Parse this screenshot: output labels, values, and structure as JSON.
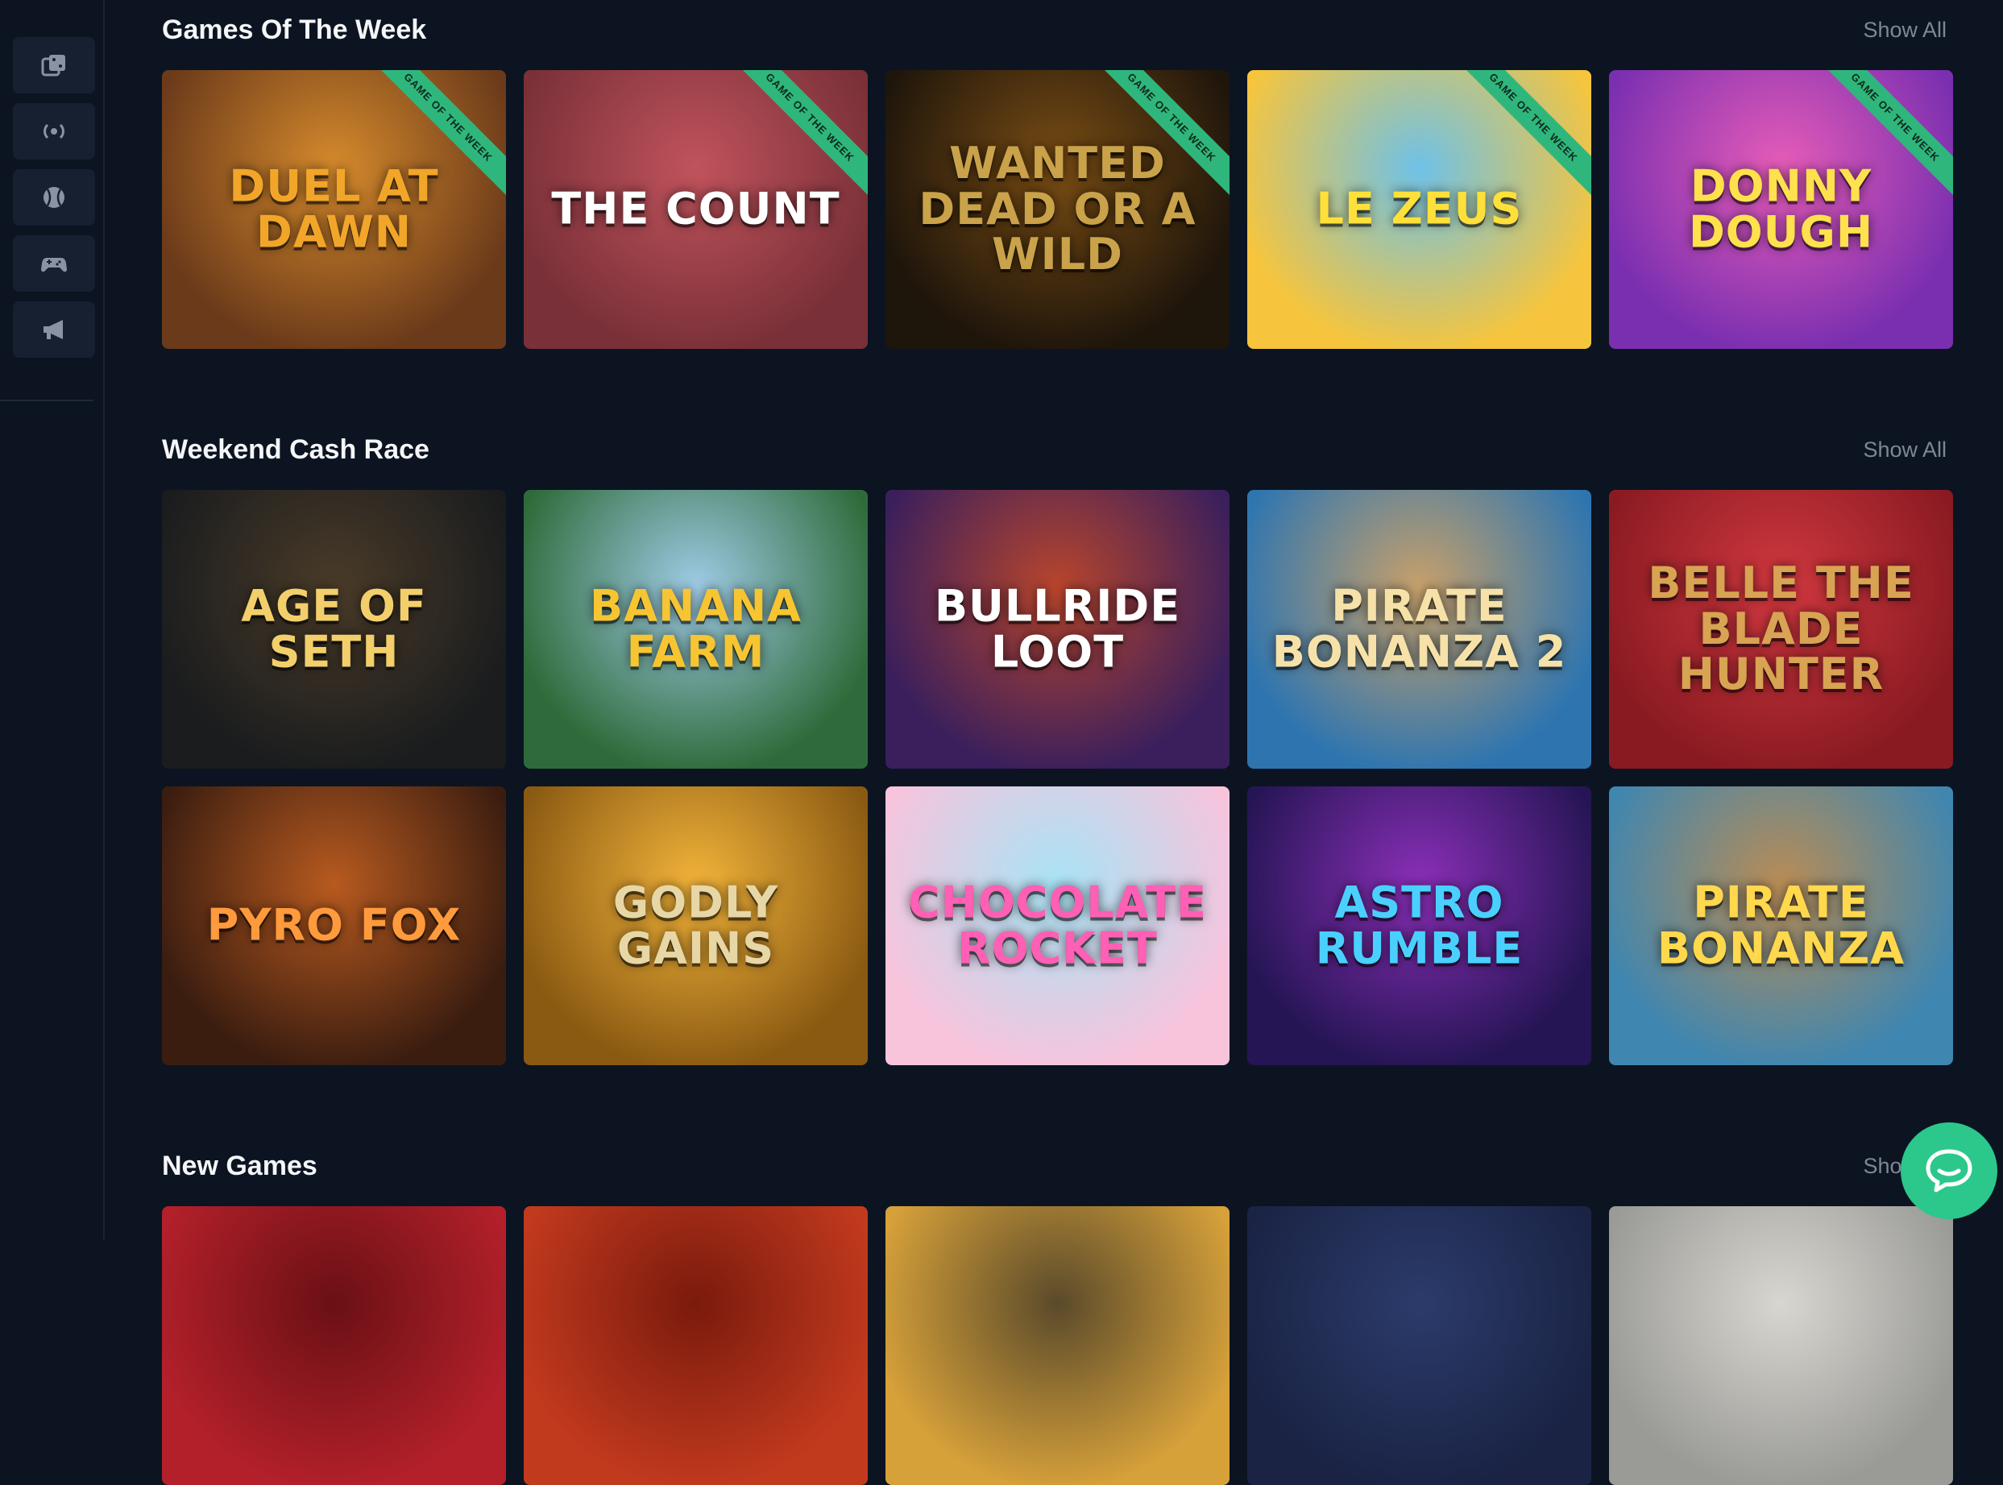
{
  "sidebar": {
    "items": [
      {
        "icon": "casino-icon"
      },
      {
        "icon": "live-icon"
      },
      {
        "icon": "sports-ball-icon"
      },
      {
        "icon": "gamepad-icon"
      },
      {
        "icon": "megaphone-icon"
      }
    ]
  },
  "sections": [
    {
      "title": "Games Of The Week",
      "show_all": "Show All",
      "ribbon_label": "GAME OF THE WEEK",
      "games": [
        {
          "title": "Duel at Dawn",
          "bg1": "#6b3a1a",
          "bg2": "#d58a2c",
          "text_color": "#f2a629"
        },
        {
          "title": "The Count",
          "bg1": "#7a3038",
          "bg2": "#c0535c",
          "text_color": "#ffffff"
        },
        {
          "title": "Wanted Dead or a Wild",
          "bg1": "#1e150b",
          "bg2": "#7a4d14",
          "text_color": "#c9a24a"
        },
        {
          "title": "Le Zeus",
          "bg1": "#f6c53d",
          "bg2": "#6ec2e8",
          "text_color": "#ffe03a"
        },
        {
          "title": "Donny Dough",
          "bg1": "#7a2fb0",
          "bg2": "#e65cb8",
          "text_color": "#ffe14d"
        }
      ]
    },
    {
      "title": "Weekend Cash Race",
      "show_all": "Show All",
      "games": [
        {
          "title": "Age of Seth",
          "bg1": "#1a1c1e",
          "bg2": "#4a3b28",
          "text_color": "#f3cf6b"
        },
        {
          "title": "Banana Farm",
          "bg1": "#2f6b3a",
          "bg2": "#9fcbe6",
          "text_color": "#f7c531"
        },
        {
          "title": "Bullride Loot",
          "bg1": "#3a1f5c",
          "bg2": "#b8452c",
          "text_color": "#ffffff"
        },
        {
          "title": "Pirate Bonanza 2",
          "bg1": "#2e75b0",
          "bg2": "#c7a06a",
          "text_color": "#f6e2a8"
        },
        {
          "title": "Belle The Blade Hunter",
          "bg1": "#8a1a22",
          "bg2": "#d1383f",
          "text_color": "#d8a352"
        },
        {
          "title": "Pyro Fox",
          "bg1": "#3b1d10",
          "bg2": "#b75a1f",
          "text_color": "#ff9a3d"
        },
        {
          "title": "Godly Gains",
          "bg1": "#8a5a12",
          "bg2": "#f2b33a",
          "text_color": "#e7d7a6"
        },
        {
          "title": "Chocolate Rocket",
          "bg1": "#f7c4dc",
          "bg2": "#a9e3f5",
          "text_color": "#ff5fb4"
        },
        {
          "title": "Astro Rumble",
          "bg1": "#251554",
          "bg2": "#8a2fb8",
          "text_color": "#4ad0ff"
        },
        {
          "title": "Pirate Bonanza",
          "bg1": "#3f86b0",
          "bg2": "#b98c55",
          "text_color": "#ffd84d"
        }
      ]
    },
    {
      "title": "New Games",
      "show_all": "Show All",
      "games": [
        {
          "bg1": "#b3202a",
          "bg2": "#6a1015"
        },
        {
          "bg1": "#c23a1e",
          "bg2": "#7a1a0d"
        },
        {
          "bg1": "#d7a13a",
          "bg2": "#5a4a2a"
        },
        {
          "bg1": "#1a2344",
          "bg2": "#2c3b6b"
        },
        {
          "bg1": "#9a9a96",
          "bg2": "#d8d6d0"
        }
      ]
    }
  ],
  "chat": {
    "icon": "chat-bubble-icon",
    "color": "#2cc78b"
  }
}
